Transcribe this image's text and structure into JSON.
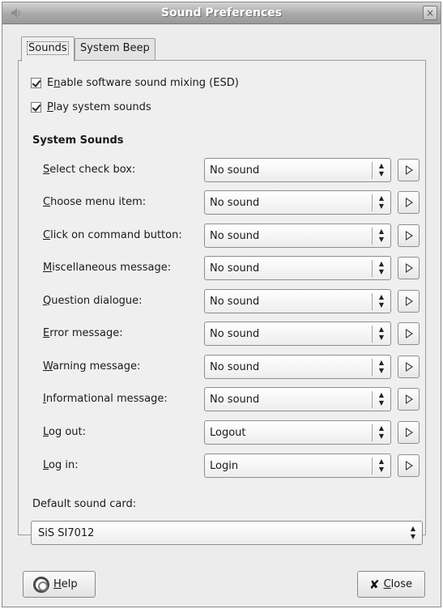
{
  "window": {
    "title": "Sound Preferences",
    "close_glyph": "×"
  },
  "tabs": [
    {
      "label": "Sounds",
      "active": true
    },
    {
      "label": "System Beep",
      "active": false
    }
  ],
  "general": {
    "esd": {
      "pre": "E",
      "mn": "n",
      "post": "able software sound mixing (ESD)",
      "checked": true
    },
    "play": {
      "pre": "",
      "mn": "P",
      "post": "lay system sounds",
      "checked": true
    }
  },
  "system_sounds": {
    "heading": "System Sounds",
    "rows": [
      {
        "pre": "",
        "mn": "S",
        "post": "elect check box:",
        "value": "No sound"
      },
      {
        "pre": "",
        "mn": "C",
        "post": "hoose menu item:",
        "value": "No sound"
      },
      {
        "pre": "",
        "mn": "C",
        "post": "lick on command button:",
        "value": "No sound"
      },
      {
        "pre": "",
        "mn": "M",
        "post": "iscellaneous message:",
        "value": "No sound"
      },
      {
        "pre": "",
        "mn": "Q",
        "post": "uestion dialogue:",
        "value": "No sound"
      },
      {
        "pre": "",
        "mn": "E",
        "post": "rror message:",
        "value": "No sound"
      },
      {
        "pre": "",
        "mn": "W",
        "post": "arning message:",
        "value": "No sound"
      },
      {
        "pre": "",
        "mn": "I",
        "post": "nformational message:",
        "value": "No sound"
      },
      {
        "pre": "",
        "mn": "L",
        "post": "og out:",
        "value": "Logout"
      },
      {
        "pre": "",
        "mn": "L",
        "post": "og in:",
        "value": "Login"
      }
    ]
  },
  "sound_card": {
    "label": "Default sound card:",
    "value": "SiS SI7012"
  },
  "buttons": {
    "help": {
      "mn": "H",
      "post": "elp"
    },
    "close": {
      "mn": "C",
      "post": "lose",
      "glyph": "✘"
    }
  },
  "icons": {
    "app": "speaker-icon",
    "play": "play-icon",
    "help": "help-lifebuoy-icon",
    "close": "close-x-icon"
  }
}
